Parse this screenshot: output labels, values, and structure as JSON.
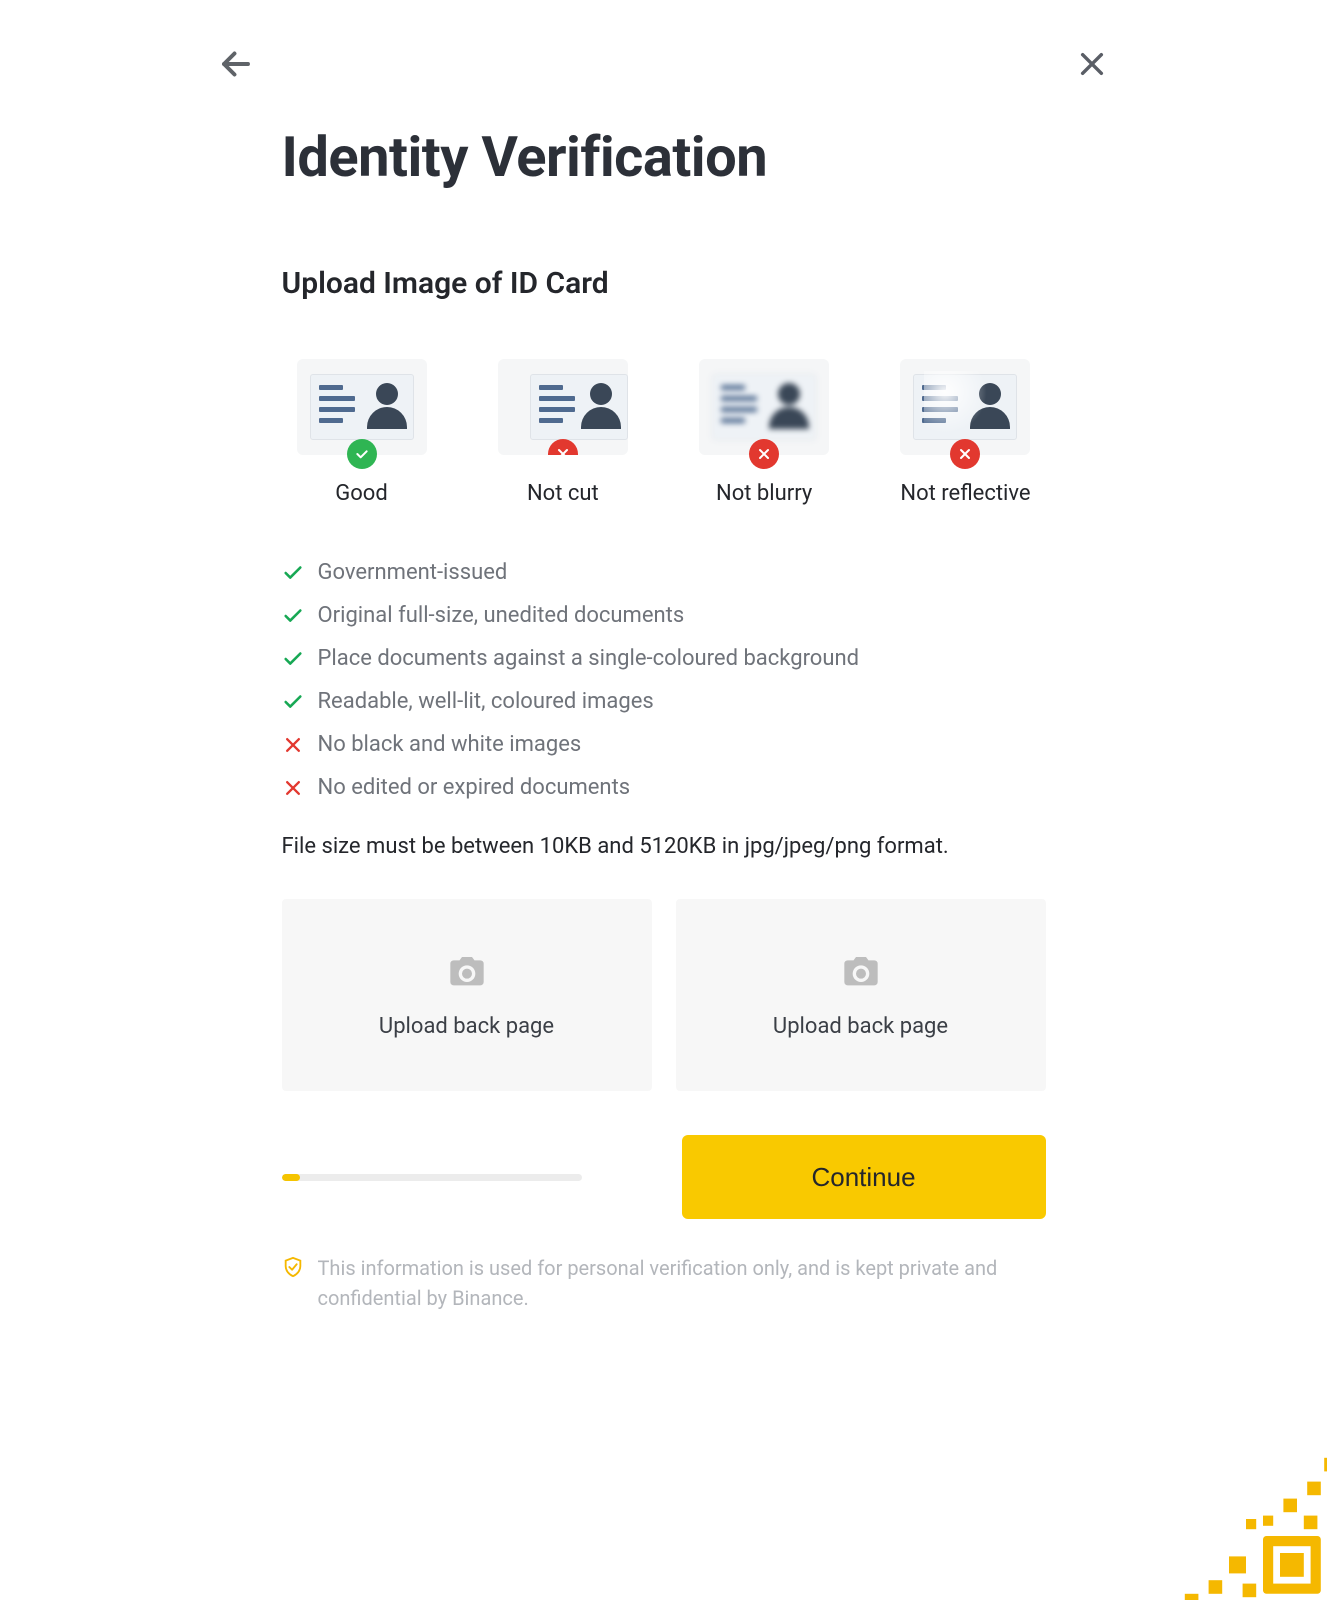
{
  "header": {
    "title": "Identity Verification",
    "subtitle": "Upload Image of ID Card"
  },
  "examples": [
    {
      "label": "Good",
      "status": "good",
      "variant": "normal"
    },
    {
      "label": "Not cut",
      "status": "bad",
      "variant": "cut"
    },
    {
      "label": "Not blurry",
      "status": "bad",
      "variant": "blurry"
    },
    {
      "label": "Not reflective",
      "status": "bad",
      "variant": "reflective"
    }
  ],
  "requirements": [
    {
      "type": "check",
      "text": "Government-issued"
    },
    {
      "type": "check",
      "text": "Original full-size, unedited documents"
    },
    {
      "type": "check",
      "text": "Place documents against a single-coloured background"
    },
    {
      "type": "check",
      "text": "Readable, well-lit, coloured images"
    },
    {
      "type": "cross",
      "text": "No black and white images"
    },
    {
      "type": "cross",
      "text": "No edited or expired documents"
    }
  ],
  "filesize_note": "File size must be between 10KB and 5120KB in jpg/jpeg/png format.",
  "upload": {
    "left_label": "Upload back page",
    "right_label": "Upload back page"
  },
  "progress_percent": 6,
  "continue_label": "Continue",
  "disclaimer": "This information is used for personal verification only, and is kept private and confidential by Binance."
}
